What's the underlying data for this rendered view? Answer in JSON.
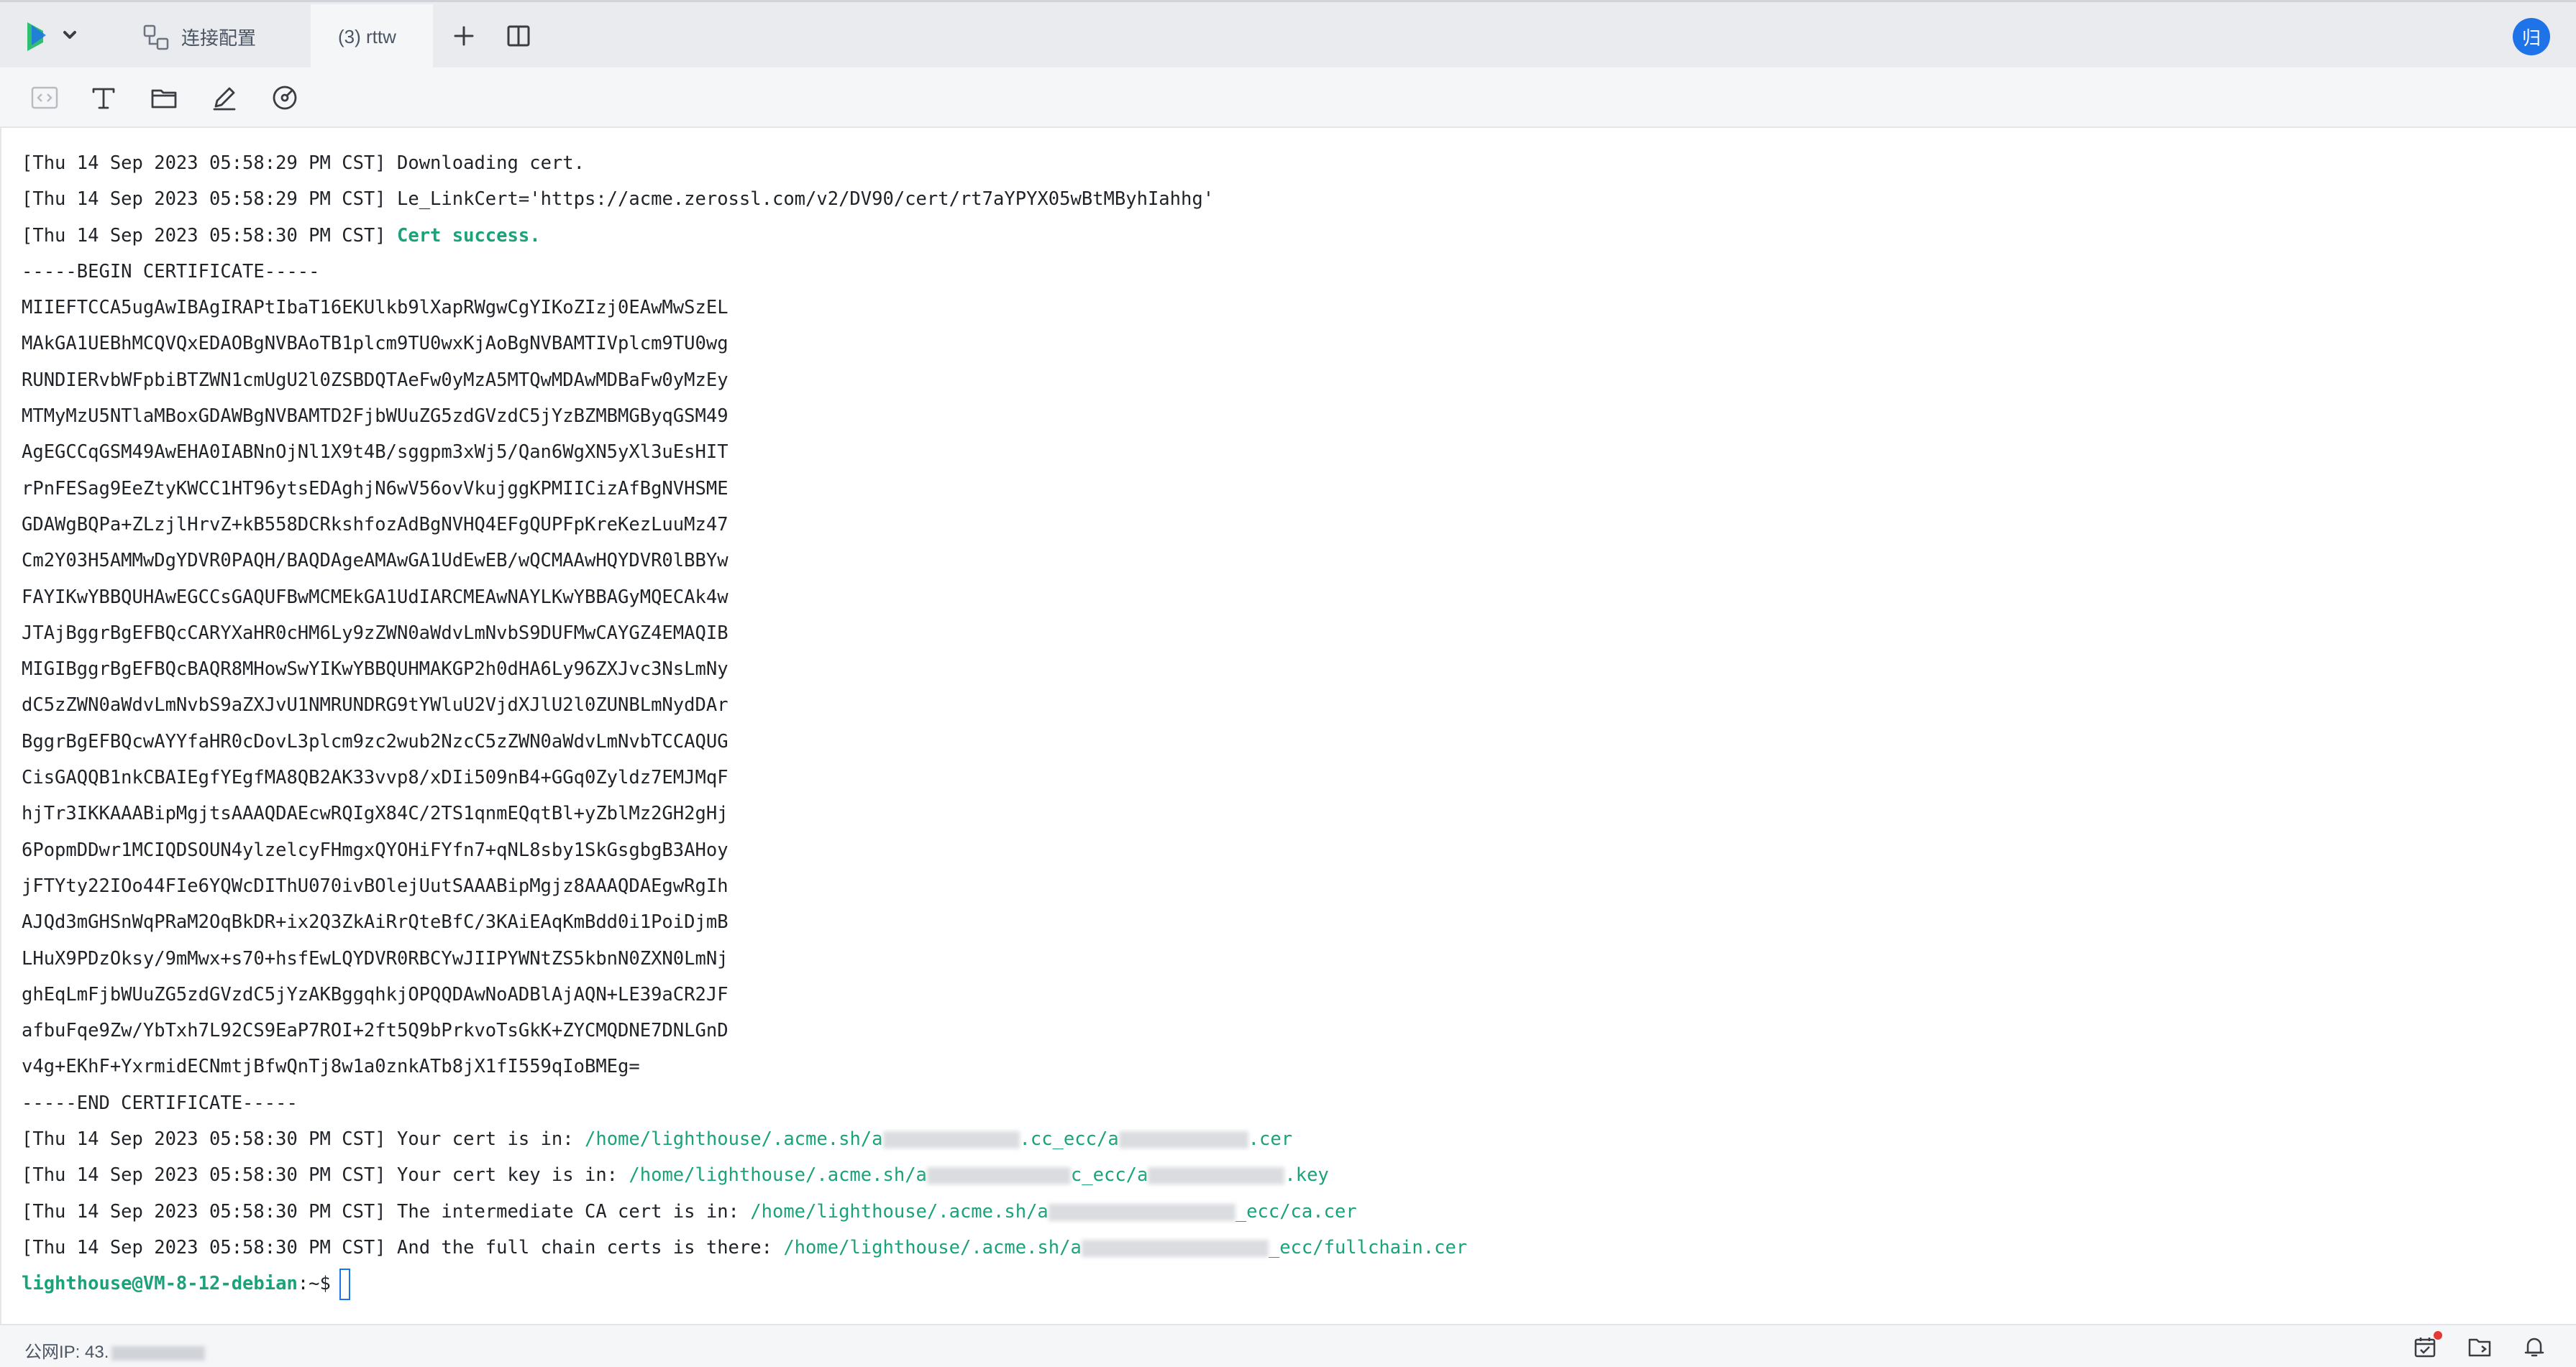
{
  "tabs": {
    "connection_config_label": "连接配置",
    "active_session_label": "(3) rttw"
  },
  "user": {
    "avatar_text": "归"
  },
  "terminal": {
    "log_lines": [
      {
        "prefix": "[Thu 14 Sep 2023 05:58:29 PM CST] ",
        "text": "Downloading cert."
      },
      {
        "prefix": "[Thu 14 Sep 2023 05:58:29 PM CST] ",
        "text": "Le_LinkCert='https://acme.zerossl.com/v2/DV90/cert/rt7aYPYX05wBtMByhIahhg'"
      },
      {
        "prefix": "[Thu 14 Sep 2023 05:58:30 PM CST] ",
        "success": "Cert success."
      }
    ],
    "cert_begin": "-----BEGIN CERTIFICATE-----",
    "cert_lines": [
      "MIIEFTCCA5ugAwIBAgIRAPtIbaT16EKUlkb9lXapRWgwCgYIKoZIzj0EAwMwSzEL",
      "MAkGA1UEBhMCQVQxEDAOBgNVBAoTB1plcm9TU0wxKjAoBgNVBAMTIVplcm9TU0wg",
      "RUNDIERvbWFpbiBTZWN1cmUgU2l0ZSBDQTAeFw0yMzA5MTQwMDAwMDBaFw0yMzEy",
      "MTMyMzU5NTlaMBoxGDAWBgNVBAMTD2FjbWUuZG5zdGVzdC5jYzBZMBMGByqGSM49",
      "AgEGCCqGSM49AwEHA0IABNnOjNl1X9t4B/sggpm3xWj5/Qan6WgXN5yXl3uEsHIT",
      "rPnFESag9EeZtyKWCC1HT96ytsEDAghjN6wV56ovVkujggKPMIICizAfBgNVHSME",
      "GDAWgBQPa+ZLzjlHrvZ+kB558DCRkshfozAdBgNVHQ4EFgQUPFpKreKezLuuMz47",
      "Cm2Y03H5AMMwDgYDVR0PAQH/BAQDAgeAMAwGA1UdEwEB/wQCMAAwHQYDVR0lBBYw",
      "FAYIKwYBBQUHAwEGCCsGAQUFBwMCMEkGA1UdIARCMEAwNAYLKwYBBAGyMQECAk4w",
      "JTAjBggrBgEFBQcCARYXaHR0cHM6Ly9zZWN0aWdvLmNvbS9DUFMwCAYGZ4EMAQIB",
      "MIGIBggrBgEFBQcBAQR8MHowSwYIKwYBBQUHMAKGP2h0dHA6Ly96ZXJvc3NsLmNy",
      "dC5zZWN0aWdvLmNvbS9aZXJvU1NMRUNDRG9tYWluU2VjdXJlU2l0ZUNBLmNydDAr",
      "BggrBgEFBQcwAYYfaHR0cDovL3plcm9zc2wub2NzcC5zZWN0aWdvLmNvbTCCAQUG",
      "CisGAQQB1nkCBAIEgfYEgfMA8QB2AK33vvp8/xDIi509nB4+GGq0Zyldz7EMJMqF",
      "hjTr3IKKAAABipMgjtsAAAQDAEcwRQIgX84C/2TS1qnmEQqtBl+yZblMz2GH2gHj",
      "6PopmDDwr1MCIQDSOUN4ylzelcyFHmgxQYOHiFYfn7+qNL8sby1SkGsgbgB3AHoy",
      "jFTYty22IOo44FIe6YQWcDIThU070ivBOlejUutSAAABipMgjz8AAAQDAEgwRgIh",
      "AJQd3mGHSnWqPRaM2OqBkDR+ix2Q3ZkAiRrQteBfC/3KAiEAqKmBdd0i1PoiDjmB",
      "LHuX9PDzOksy/9mMwx+s70+hsfEwLQYDVR0RBCYwJIIPYWNtZS5kbnN0ZXN0LmNj",
      "ghEqLmFjbWUuZG5zdGVzdC5jYzAKBggqhkjOPQQDAwNoADBlAjAQN+LE39aCR2JF",
      "afbuFqe9Zw/YbTxh7L92CS9EaP7ROI+2ft5Q9bPrkvoTsGkK+ZYCMQDNE7DNLGnD",
      "v4g+EKhF+YxrmidECNmtjBfwQnTj8w1a0znkATb8jX1fI559qIoBMEg="
    ],
    "cert_end": "-----END CERTIFICATE-----",
    "path_lines": [
      {
        "prefix": "[Thu 14 Sep 2023 05:58:30 PM CST] ",
        "label": "Your cert is in: ",
        "path_start": "/home/lighthouse/.acme.sh/a",
        "path_mid": ".cc_ecc/a",
        "path_end": ".cer"
      },
      {
        "prefix": "[Thu 14 Sep 2023 05:58:30 PM CST] ",
        "label": "Your cert key is in: ",
        "path_start": "/home/lighthouse/.acme.sh/a",
        "path_mid": "c_ecc/a",
        "path_end": ".key"
      },
      {
        "prefix": "[Thu 14 Sep 2023 05:58:30 PM CST] ",
        "label": "The intermediate CA cert is in: ",
        "path_start": "/home/lighthouse/.acme.sh/a",
        "path_mid": "_ecc/c",
        "path_end": "a.cer"
      },
      {
        "prefix": "[Thu 14 Sep 2023 05:58:30 PM CST] ",
        "label": "And the full chain certs is there: ",
        "path_start": "/home/lighthouse/.acme.sh/a",
        "path_mid": "_ecc/fullchain.cer",
        "path_end": ""
      }
    ],
    "prompt_user": "lighthouse@VM-8-12-debian",
    "prompt_suffix": ":~$"
  },
  "help": {
    "label": "?"
  },
  "statusbar": {
    "public_ip_label": "公网IP: 43."
  },
  "colors": {
    "accent": "#1e73e8",
    "success_green": "#1aa37a",
    "notification_dot": "#e53935"
  },
  "icons": {
    "tabbar": [
      "app-logo-icon",
      "chevron-down-icon",
      "connection-config-icon",
      "plus-icon",
      "split-view-icon"
    ],
    "toolbar": [
      "code-icon",
      "text-format-icon",
      "folder-icon",
      "edit-icon",
      "speedometer-icon"
    ],
    "statusbar": [
      "calendar-icon",
      "folder-sync-icon",
      "bell-icon"
    ]
  }
}
